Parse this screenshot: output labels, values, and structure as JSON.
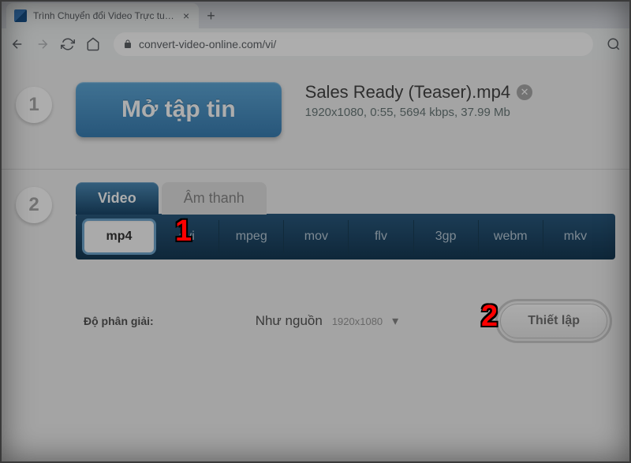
{
  "browser": {
    "tab_title": "Trình Chuyển đổi Video Trực tuyến",
    "url": "convert-video-online.com/vi/"
  },
  "step1": {
    "number": "1",
    "open_file_label": "Mở tập tin",
    "file_name": "Sales Ready (Teaser).mp4",
    "file_meta": "1920x1080, 0:55, 5694 kbps, 37.99 Mb"
  },
  "step2": {
    "number": "2",
    "tabs": {
      "video": "Video",
      "audio": "Âm thanh"
    },
    "formats": [
      "mp4",
      "avi",
      "mpeg",
      "mov",
      "flv",
      "3gp",
      "webm",
      "mkv"
    ],
    "resolution_label": "Độ phân giải:",
    "resolution_selected": "Như nguồn",
    "resolution_value": "1920x1080",
    "settings_label": "Thiết lập"
  },
  "annotations": {
    "a1": "1",
    "a2": "2"
  }
}
